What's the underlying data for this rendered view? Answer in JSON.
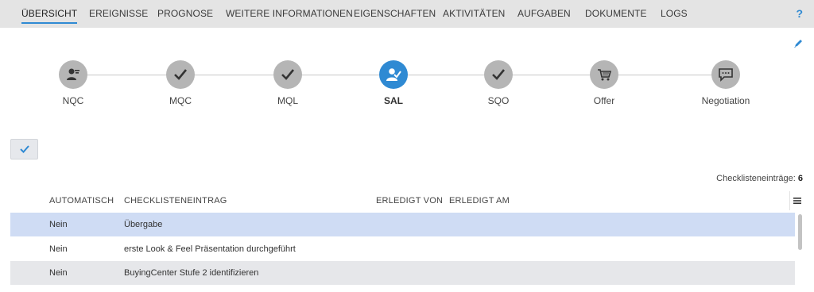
{
  "tabs": [
    {
      "label": "ÜBERSICHT",
      "active": true
    },
    {
      "label": "EREIGNISSE"
    },
    {
      "label": "PROGNOSE"
    },
    {
      "label": "WEITERE INFORMATIONEN"
    },
    {
      "label": "EIGENSCHAFTEN"
    },
    {
      "label": "AKTIVITÄTEN"
    },
    {
      "label": "AUFGABEN"
    },
    {
      "label": "DOKUMENTE"
    },
    {
      "label": "LOGS"
    }
  ],
  "help_label": "?",
  "stages": [
    {
      "label": "NQC",
      "icon": "person-filter-icon"
    },
    {
      "label": "MQC",
      "icon": "checkmark-icon"
    },
    {
      "label": "MQL",
      "icon": "checkmark-icon"
    },
    {
      "label": "SAL",
      "icon": "person-check-icon",
      "current": true
    },
    {
      "label": "SQO",
      "icon": "checkmark-icon"
    },
    {
      "label": "Offer",
      "icon": "shopping-cart-icon"
    },
    {
      "label": "Negotiation",
      "icon": "chat-bubble-icon"
    }
  ],
  "checklist_count": {
    "label": "Checklisteneinträge:",
    "value": "6"
  },
  "columns": {
    "automatic": "AUTOMATISCH",
    "entry": "CHECKLISTENEINTRAG",
    "done_by": "ERLEDIGT VON",
    "done_at": "ERLEDIGT AM"
  },
  "rows": [
    {
      "automatic": "Nein",
      "entry": "Übergabe",
      "done_by": "",
      "done_at": ""
    },
    {
      "automatic": "Nein",
      "entry": "erste Look & Feel Präsentation durchgeführt",
      "done_by": "",
      "done_at": ""
    },
    {
      "automatic": "Nein",
      "entry": "BuyingCenter Stufe 2 identifizieren",
      "done_by": "",
      "done_at": ""
    }
  ],
  "colors": {
    "accent": "#2f8ad3",
    "step_inactive": "#b5b5b5",
    "row_selected": "#cfdcf4",
    "row_alt": "#e6e7ea"
  }
}
